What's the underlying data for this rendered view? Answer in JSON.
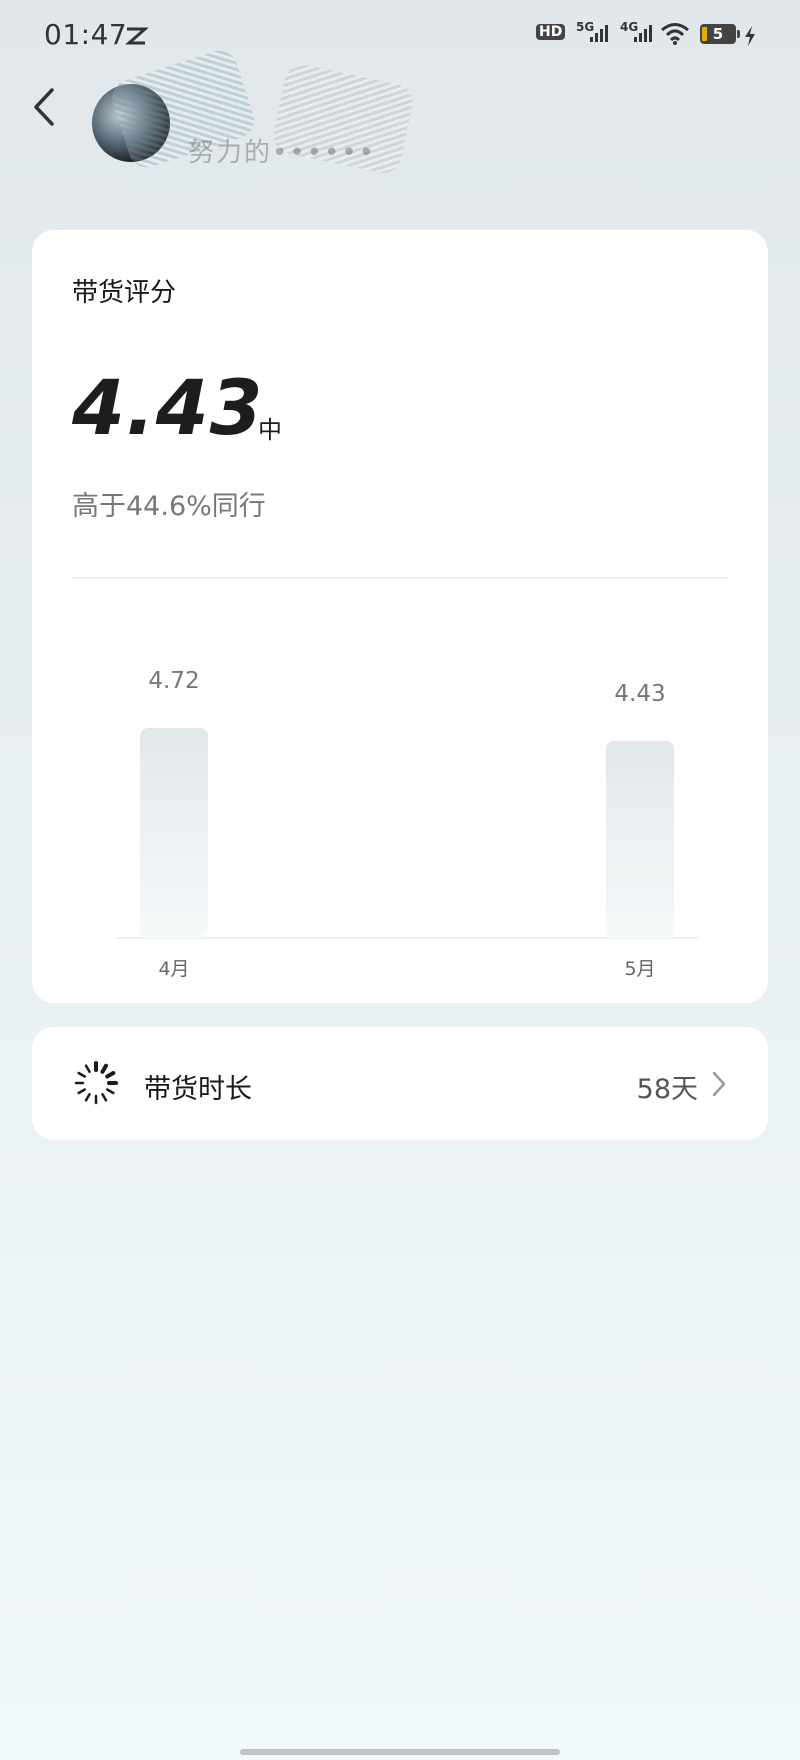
{
  "status_bar": {
    "time": "01:47",
    "indicators": [
      "HD",
      "5G",
      "4G"
    ],
    "battery_level": "5",
    "icons": [
      "hd-voice-icon",
      "signal-5g-icon",
      "signal-4g-icon",
      "wifi-icon",
      "battery-icon",
      "charging-icon"
    ]
  },
  "header": {
    "back_icon": "chevron-left-icon",
    "nickname": "努力的••••••",
    "avatar": "user-avatar"
  },
  "score_card": {
    "title": "带货评分",
    "score": "4.43",
    "level": "中",
    "compare_text": "高于44.6%同行"
  },
  "chart_data": {
    "type": "bar",
    "categories": [
      "4月",
      "5月"
    ],
    "values": [
      4.72,
      4.43
    ],
    "data_labels": [
      "4.72",
      "4.43"
    ],
    "bar_color_top": "#e2e8ea",
    "bar_color_bottom": "#f6f9fa"
  },
  "duration_card": {
    "icon": "loading-spinner-icon",
    "label": "带货时长",
    "value": "58天",
    "chevron_icon": "chevron-right-icon"
  },
  "colors": {
    "background_top": "#e1e7ea",
    "background_bottom": "#f1f8fb",
    "card": "#ffffff",
    "primary_text": "#1a1a1a",
    "secondary_text": "#777777"
  }
}
